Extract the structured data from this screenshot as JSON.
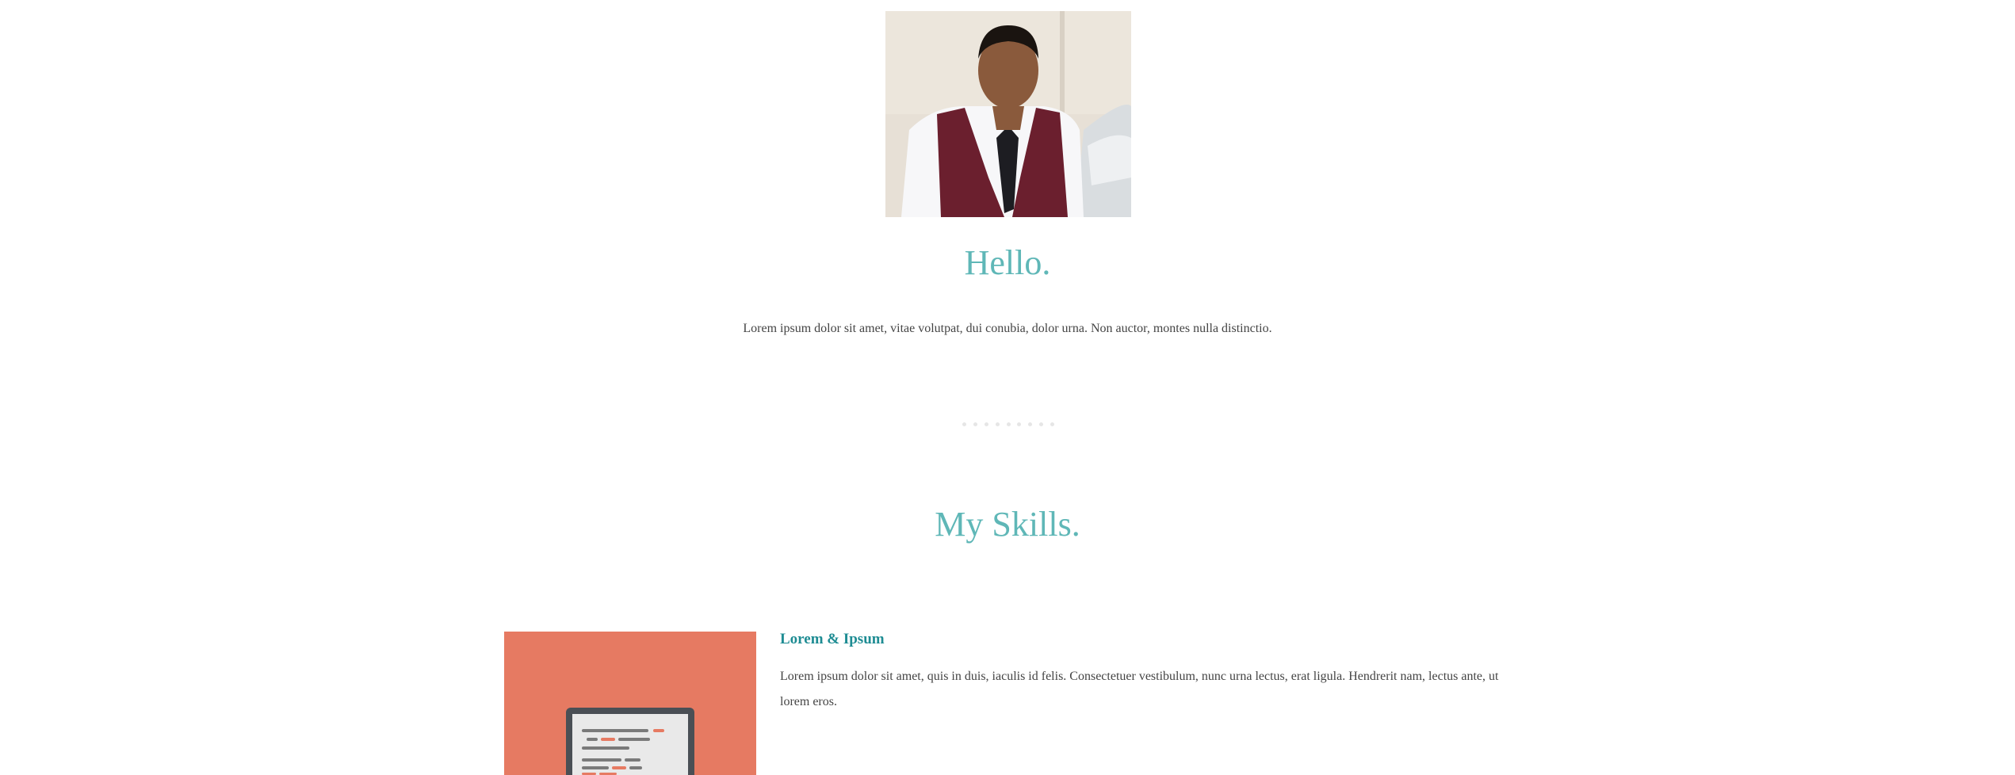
{
  "profile": {
    "photo_icon": "portrait-photo",
    "greeting": "Hello.",
    "intro": "Lorem ipsum dolor sit amet, vitae volutpat, dui conubia, dolor urna. Non auctor, montes nulla distinctio."
  },
  "divider": {
    "dot_count": 9
  },
  "skills": {
    "title": "My Skills.",
    "items": [
      {
        "icon": "laptop-code-illustration",
        "title": "Lorem & Ipsum",
        "text": "Lorem ipsum dolor sit amet, quis in duis, iaculis id felis. Consectetuer vestibulum, nunc urna lectus, erat ligula. Hendrerit nam, lectus ante, ut lorem eros."
      }
    ]
  },
  "colors": {
    "accent": "#5fb7b7",
    "skill_title": "#1e8c93",
    "skill_tile": "#e67a62",
    "text": "#444444"
  }
}
